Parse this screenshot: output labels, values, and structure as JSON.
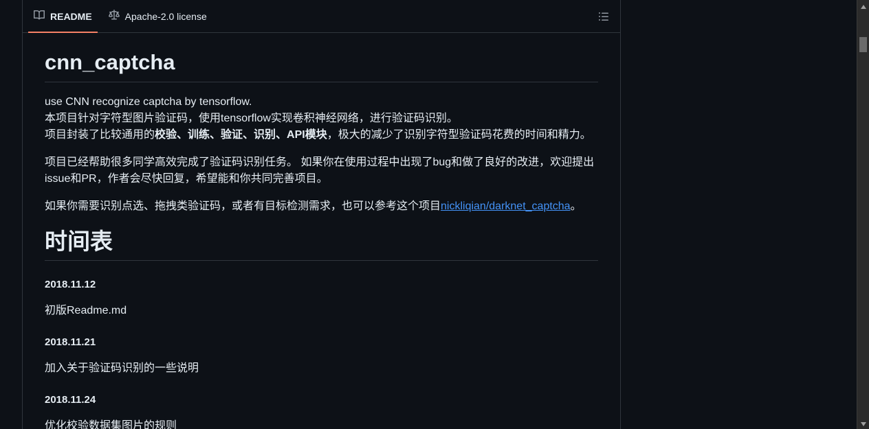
{
  "tabs": {
    "readme_label": "README",
    "license_label": "Apache-2.0 license"
  },
  "icons": {
    "readme": "book-icon",
    "license": "scale-icon",
    "toc": "list-unordered-icon"
  },
  "colors": {
    "background": "#0d1117",
    "text": "#e6edf3",
    "border": "#30363d",
    "link": "#4493f8",
    "tab_underline": "#f78166"
  },
  "readme": {
    "title": "cnn_captcha",
    "intro_line1": "use CNN recognize captcha by tensorflow.",
    "intro_line2": "本项目针对字符型图片验证码，使用tensorflow实现卷积神经网络，进行验证码识别。",
    "intro_line3_prefix": "项目封装了比较通用的",
    "intro_line3_bold": "校验、训练、验证、识别、API模块",
    "intro_line3_suffix": "，极大的减少了识别字符型验证码花费的时间和精力。",
    "para2": "项目已经帮助很多同学高效完成了验证码识别任务。 如果你在使用过程中出现了bug和做了良好的改进，欢迎提出issue和PR，作者会尽快回复，希望能和你共同完善项目。",
    "para3_prefix": "如果你需要识别点选、拖拽类验证码，或者有目标检测需求，也可以参考这个项目",
    "para3_link": "nickliqian/darknet_captcha",
    "para3_suffix": "。",
    "section_title": "时间表",
    "timeline": [
      {
        "date": "2018.11.12",
        "text": "初版Readme.md"
      },
      {
        "date": "2018.11.21",
        "text": "加入关于验证码识别的一些说明"
      },
      {
        "date": "2018.11.24",
        "text": "优化校验数据集图片的规则"
      }
    ]
  }
}
